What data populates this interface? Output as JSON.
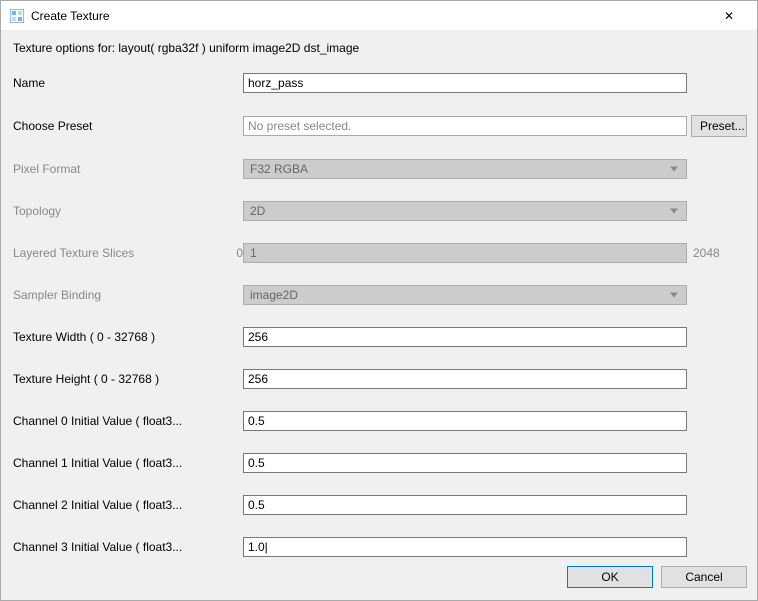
{
  "window": {
    "title": "Create Texture",
    "close_icon": "✕"
  },
  "subheader": "Texture options for: layout( rgba32f ) uniform image2D dst_image",
  "labels": {
    "name": "Name",
    "choose_preset": "Choose Preset",
    "pixel_format": "Pixel Format",
    "topology": "Topology",
    "layered_slices": "Layered Texture Slices",
    "sampler_binding": "Sampler Binding",
    "tex_width": "Texture Width ( 0 - 32768 )",
    "tex_height": "Texture Height ( 0 - 32768 )",
    "ch0": "Channel 0 Initial Value ( float3...",
    "ch1": "Channel 1 Initial Value ( float3...",
    "ch2": "Channel 2 Initial Value ( float3...",
    "ch3": "Channel 3 Initial Value ( float3..."
  },
  "values": {
    "name": "horz_pass",
    "preset_placeholder": "No preset selected.",
    "pixel_format": "F32 RGBA",
    "topology": "2D",
    "layered_min": "0",
    "layered_val": "1",
    "layered_max": "2048",
    "sampler_binding": "image2D",
    "tex_width": "256",
    "tex_height": "256",
    "ch0": "0.5",
    "ch1": "0.5",
    "ch2": "0.5",
    "ch3": "1.0|"
  },
  "buttons": {
    "preset": "Preset...",
    "ok": "OK",
    "cancel": "Cancel"
  }
}
